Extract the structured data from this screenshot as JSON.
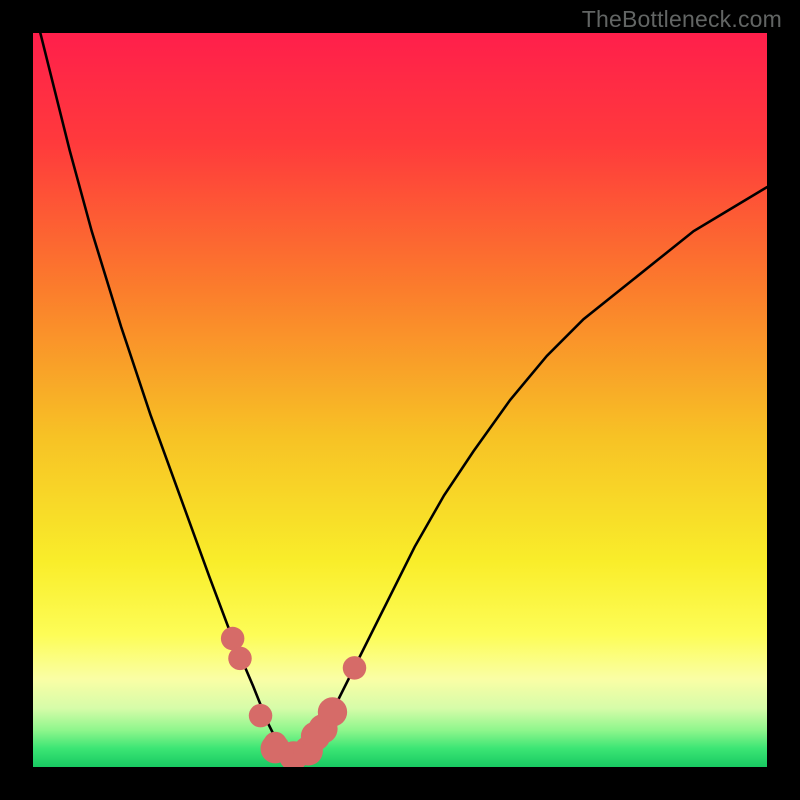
{
  "watermark": "TheBottleneck.com",
  "chart_data": {
    "type": "line",
    "title": "",
    "xlabel": "",
    "ylabel": "",
    "xlim": [
      0,
      100
    ],
    "ylim": [
      0,
      100
    ],
    "series": [
      {
        "name": "curve",
        "color": "#000000",
        "x": [
          1,
          3,
          5,
          8,
          12,
          16,
          20,
          24,
          27,
          30,
          32,
          33,
          34,
          35,
          36,
          37,
          40,
          44,
          48,
          52,
          56,
          60,
          65,
          70,
          75,
          80,
          85,
          90,
          95,
          100
        ],
        "y": [
          100,
          92,
          84,
          73,
          60,
          48,
          37,
          26,
          18,
          11,
          6,
          4,
          2,
          1,
          1,
          2,
          6,
          14,
          22,
          30,
          37,
          43,
          50,
          56,
          61,
          65,
          69,
          73,
          76,
          79
        ]
      }
    ],
    "markers": {
      "color": "#d66b68",
      "points": [
        {
          "x": 27.2,
          "y": 17.5,
          "r": 1.6
        },
        {
          "x": 28.2,
          "y": 14.8,
          "r": 1.6
        },
        {
          "x": 31.0,
          "y": 7.0,
          "r": 1.6
        },
        {
          "x": 33.0,
          "y": 3.2,
          "r": 1.6
        },
        {
          "x": 33.0,
          "y": 2.5,
          "r": 2.0
        },
        {
          "x": 35.5,
          "y": 1.5,
          "r": 2.0
        },
        {
          "x": 37.5,
          "y": 2.2,
          "r": 2.0
        },
        {
          "x": 38.5,
          "y": 4.2,
          "r": 2.0
        },
        {
          "x": 39.5,
          "y": 5.2,
          "r": 2.0
        },
        {
          "x": 40.8,
          "y": 7.5,
          "r": 2.0
        },
        {
          "x": 43.8,
          "y": 13.5,
          "r": 1.6
        }
      ]
    },
    "gradient": {
      "stops": [
        {
          "offset": 0,
          "color": "#ff1f4b"
        },
        {
          "offset": 0.15,
          "color": "#ff3a3c"
        },
        {
          "offset": 0.35,
          "color": "#fb7d2c"
        },
        {
          "offset": 0.55,
          "color": "#f7c225"
        },
        {
          "offset": 0.72,
          "color": "#f9ed2a"
        },
        {
          "offset": 0.82,
          "color": "#fdfd57"
        },
        {
          "offset": 0.88,
          "color": "#fafea5"
        },
        {
          "offset": 0.92,
          "color": "#d6fca9"
        },
        {
          "offset": 0.95,
          "color": "#8ef68c"
        },
        {
          "offset": 0.975,
          "color": "#3be574"
        },
        {
          "offset": 1.0,
          "color": "#18c962"
        }
      ]
    }
  }
}
